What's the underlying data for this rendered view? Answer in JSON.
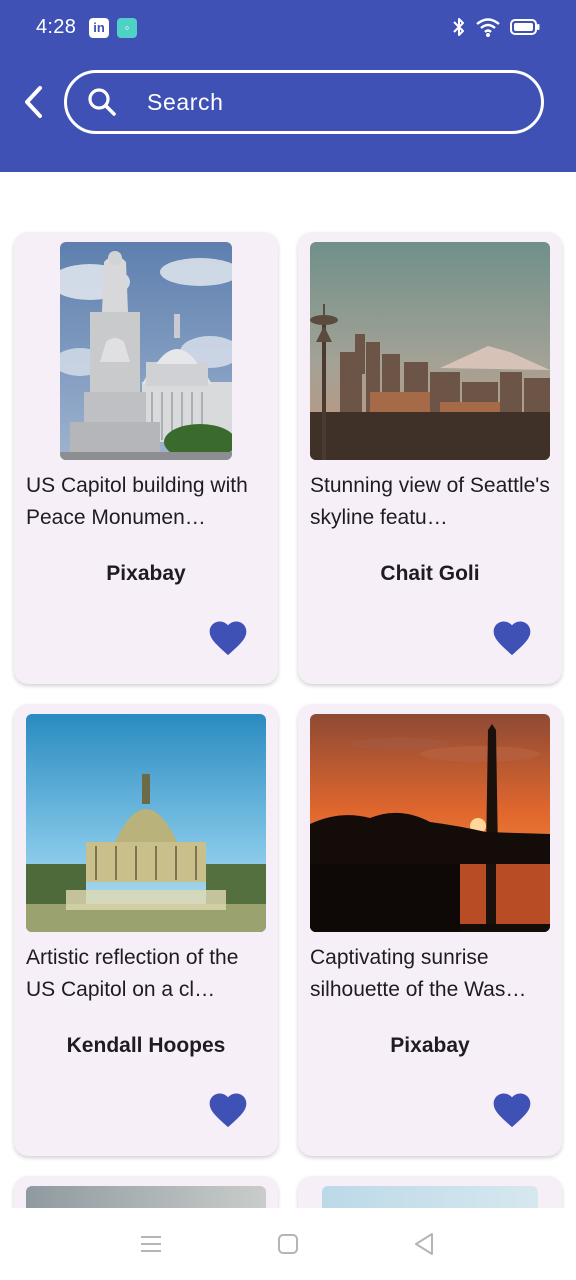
{
  "status_bar": {
    "time": "4:28",
    "apps": [
      "in",
      "◦"
    ],
    "icons": [
      "bluetooth-icon",
      "wifi-icon",
      "battery-icon"
    ]
  },
  "header": {
    "back_icon": "chevron-left-icon",
    "search_icon": "search-icon",
    "search_placeholder": "Search"
  },
  "colors": {
    "primary": "#3f51b5",
    "card_background": "#f6eff8",
    "text": "#1f1b24"
  },
  "cards": [
    {
      "description": "US Capitol building with Peace Monumen…",
      "author": "Pixabay",
      "favorite": true,
      "image": "us-capitol-peace-monument"
    },
    {
      "description": "Stunning view of Seattle's skyline featu…",
      "author": "Chait Goli",
      "favorite": true,
      "image": "seattle-skyline"
    },
    {
      "description": "Artistic reflection of the US Capitol on a cl…",
      "author": "Kendall Hoopes",
      "favorite": true,
      "image": "capitol-reflection"
    },
    {
      "description": "Captivating sunrise silhouette of the Was…",
      "author": "Pixabay",
      "favorite": true,
      "image": "washington-monument-sunrise"
    }
  ],
  "nav_bar": {
    "icons": [
      "menu-icon",
      "home-square-icon",
      "back-triangle-icon"
    ]
  }
}
